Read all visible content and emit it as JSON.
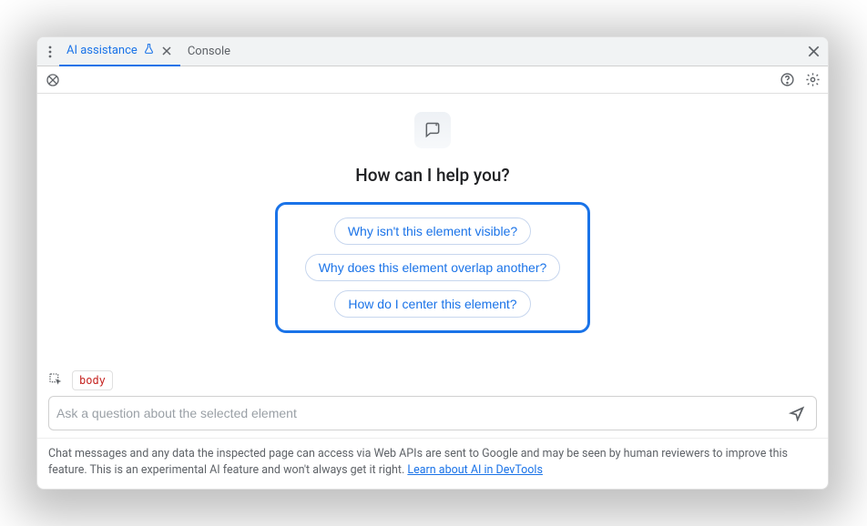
{
  "tabs": {
    "active": "AI assistance",
    "secondary": "Console"
  },
  "hero": {
    "title": "How can I help you?"
  },
  "suggestions": [
    "Why isn't this element visible?",
    "Why does this element overlap another?",
    "How do I center this element?"
  ],
  "context": {
    "element": "body"
  },
  "input": {
    "placeholder": "Ask a question about the selected element",
    "value": ""
  },
  "footer": {
    "text": "Chat messages and any data the inspected page can access via Web APIs are sent to Google and may be seen by human reviewers to improve this feature. This is an experimental AI feature and won't always get it right. ",
    "link_text": "Learn about AI in DevTools"
  }
}
